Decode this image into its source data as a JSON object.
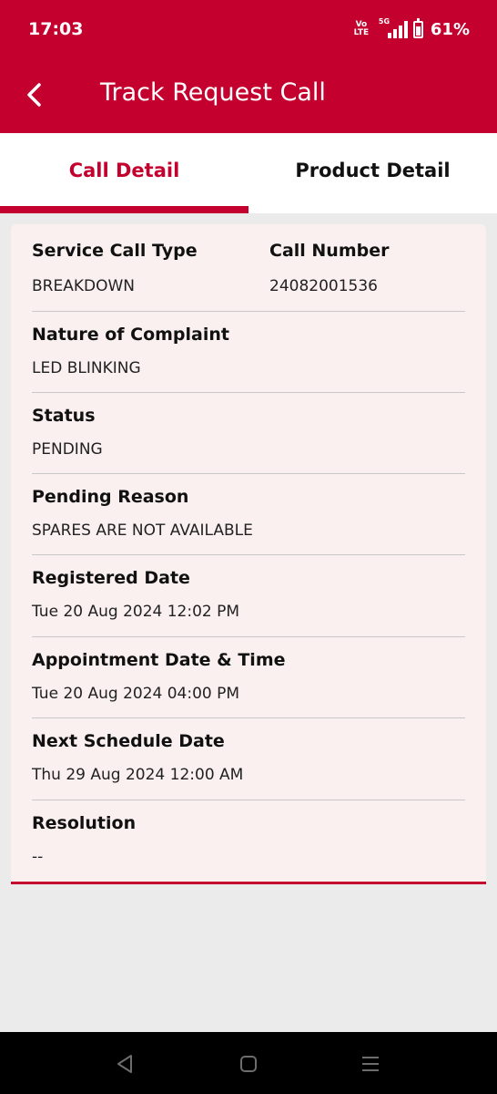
{
  "status_bar": {
    "time": "17:03",
    "volte": "Vo LTE",
    "network": "5G",
    "battery": "61%"
  },
  "app_bar": {
    "title": "Track Request Call"
  },
  "tabs": [
    {
      "label": "Call Detail"
    },
    {
      "label": "Product Detail"
    }
  ],
  "details": {
    "service_call_type": {
      "label": "Service Call Type",
      "value": "BREAKDOWN"
    },
    "call_number": {
      "label": "Call Number",
      "value": "24082001536"
    },
    "nature_of_complaint": {
      "label": "Nature of Complaint",
      "value": "LED BLINKING"
    },
    "status": {
      "label": "Status",
      "value": "PENDING"
    },
    "pending_reason": {
      "label": "Pending Reason",
      "value": "SPARES ARE NOT AVAILABLE"
    },
    "registered_date": {
      "label": "Registered Date",
      "value": "Tue 20 Aug 2024 12:02 PM"
    },
    "appointment": {
      "label": "Appointment Date & Time",
      "value": "Tue 20 Aug 2024 04:00 PM"
    },
    "next_schedule": {
      "label": "Next Schedule Date",
      "value": "Thu 29 Aug 2024 12:00 AM"
    },
    "resolution": {
      "label": "Resolution",
      "value": "--"
    }
  },
  "colors": {
    "brand": "#c4002f",
    "card_bg": "#faf0f0",
    "page_bg": "#ebebeb"
  }
}
